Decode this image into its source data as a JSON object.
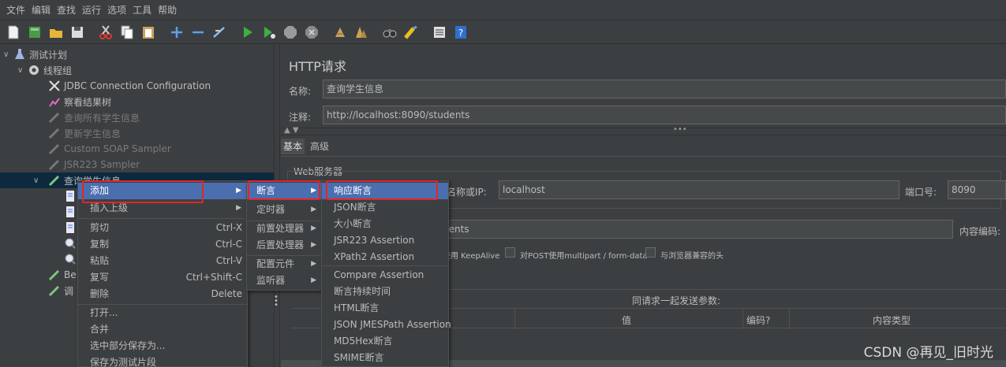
{
  "menubar": [
    "文件",
    "编辑",
    "查找",
    "运行",
    "选项",
    "工具",
    "帮助"
  ],
  "toolbar_icons": [
    "new-icon",
    "templates-icon",
    "open-icon",
    "save-icon",
    "cut-icon",
    "copy-icon",
    "paste-icon",
    "expand-icon",
    "collapse-icon",
    "toggle-icon",
    "start-icon",
    "start-no-pause-icon",
    "stop-icon",
    "shutdown-icon",
    "clear-icon",
    "clear-all-icon",
    "search-icon",
    "reset-search-icon",
    "function-helper-icon",
    "help-icon"
  ],
  "tree": {
    "test_plan": "测试计划",
    "thread_group": "线程组",
    "items": [
      "JDBC Connection Configuration",
      "察看结果树",
      "查询所有学生信息",
      "更新学生信息",
      "Custom SOAP Sampler",
      "JSR223 Sampler",
      "查询学生信息"
    ],
    "lower_a": "Be",
    "lower_b": "调"
  },
  "right": {
    "title": "HTTP请求",
    "name_label": "名称:",
    "name_value": "查询学生信息",
    "comment_label": "注释:",
    "comment_value": "http://localhost:8090/students",
    "tab_basic": "基本",
    "tab_advanced": "高级",
    "web_server": "Web服务器",
    "server_label": "名称或IP:",
    "server_value": "localhost",
    "port_label": "端口号:",
    "port_value": "8090",
    "path_value": "dents",
    "encoding_label": "内容编码:",
    "keepalive": "使用 KeepAlive",
    "multipart": "对POST使用multipart / form-data",
    "browser_headers": "与浏览器兼容的头",
    "params_title": "同请求一起发送参数:",
    "col_value": "值",
    "col_encode": "编码?",
    "col_content_type": "内容类型"
  },
  "context_menu": {
    "items": [
      {
        "label": "添加",
        "submenu": true
      },
      {
        "label": "插入上级",
        "submenu": true
      },
      {
        "label": "剪切",
        "shortcut": "Ctrl-X"
      },
      {
        "label": "复制",
        "shortcut": "Ctrl-C"
      },
      {
        "label": "粘贴",
        "shortcut": "Ctrl-V"
      },
      {
        "label": "复写",
        "shortcut": "Ctrl+Shift-C"
      },
      {
        "label": "删除",
        "shortcut": "Delete"
      },
      {
        "label": "打开..."
      },
      {
        "label": "合并"
      },
      {
        "label": "选中部分保存为..."
      },
      {
        "label": "保存为测试片段"
      }
    ]
  },
  "add_submenu": {
    "items": [
      "断言",
      "定时器",
      "前置处理器",
      "后置处理器",
      "配置元件",
      "监听器"
    ]
  },
  "assertion_submenu": {
    "items": [
      "响应断言",
      "JSON断言",
      "大小断言",
      "JSR223 Assertion",
      "XPath2 Assertion",
      "Compare Assertion",
      "断言持续时间",
      "HTML断言",
      "JSON JMESPath Assertion",
      "MD5Hex断言",
      "SMIME断言"
    ]
  },
  "watermark": "CSDN @再见_旧时光",
  "colors": {
    "background": "#3c3f41",
    "highlight": "#4b6eaf",
    "annotation_red": "#e0262b"
  }
}
